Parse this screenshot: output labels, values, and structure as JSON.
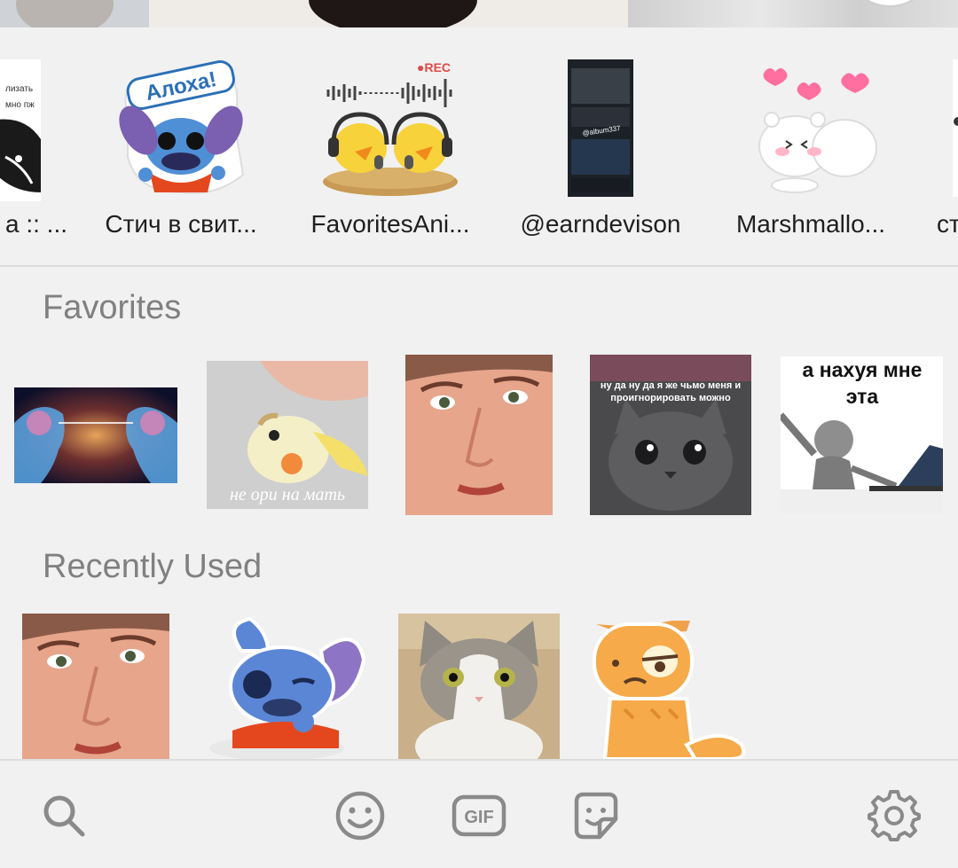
{
  "packs": [
    {
      "name": "а :: ...",
      "icon": "manga-sticker"
    },
    {
      "name": "Стич в свит...",
      "icon": "stitch-aloha-sticker",
      "thumb_text": "Алоха!"
    },
    {
      "name": "FavoritesAni...",
      "icon": "ducks-podcast-sticker",
      "thumb_text": "●REC"
    },
    {
      "name": "@earndevison",
      "icon": "phone-screenshot-sticker",
      "thumb_text": "@album337"
    },
    {
      "name": "Marshmallo...",
      "icon": "marshmallow-bears-sticker"
    },
    {
      "name": "ст",
      "icon": "partial-sticker"
    }
  ],
  "favorites": {
    "title": "Favorites",
    "items": [
      {
        "icon": "brain-heads-sticker"
      },
      {
        "icon": "parrot-sticker",
        "caption": "не ори на мать"
      },
      {
        "icon": "man-face-sticker"
      },
      {
        "icon": "sad-cat-sticker",
        "caption": "ну да ну да я же чьмо меня и проигнорировать можно"
      },
      {
        "icon": "computer-figure-sticker",
        "caption": "а нахуя мне эта информация"
      }
    ]
  },
  "recent": {
    "title": "Recently Used",
    "items": [
      {
        "icon": "man-face-sticker"
      },
      {
        "icon": "sleepy-stitch-sticker"
      },
      {
        "icon": "cat-photo-sticker"
      },
      {
        "icon": "grumpy-orange-cat-sticker"
      }
    ]
  },
  "bottom_bar": {
    "search": "search-icon",
    "emoji": "emoji-icon",
    "gif": "GIF",
    "stickers": "sticker-icon",
    "settings": "gear-icon"
  },
  "colors": {
    "background": "#f1f1f1",
    "section_title": "#808080",
    "icon": "#8a8a8a"
  }
}
